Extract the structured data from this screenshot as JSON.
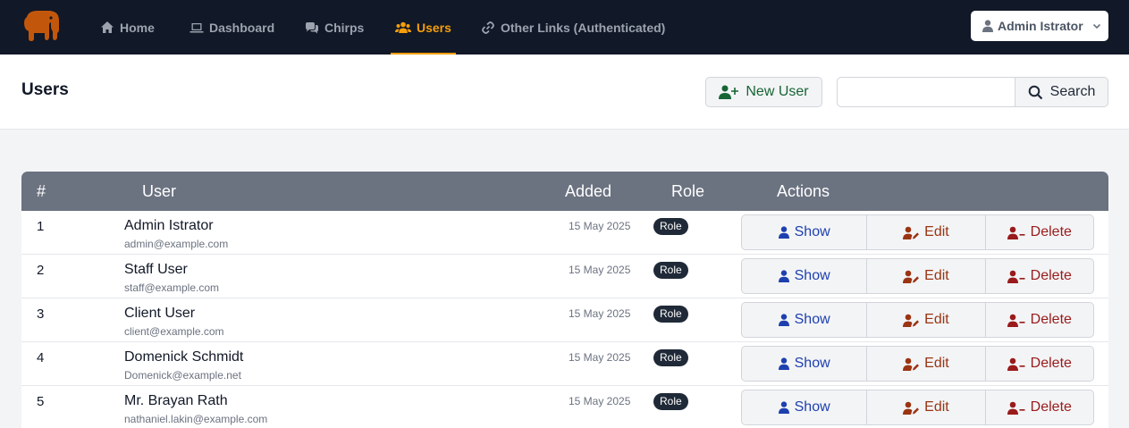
{
  "app": {
    "logo_icon": "elephant-logo-icon",
    "brand_color": "#f59e0b"
  },
  "nav": {
    "items": [
      {
        "label": "Home",
        "icon": "home-icon"
      },
      {
        "label": "Dashboard",
        "icon": "laptop-icon"
      },
      {
        "label": "Chirps",
        "icon": "chat-bubbles-icon"
      },
      {
        "label": "Users",
        "icon": "users-icon",
        "active": true
      },
      {
        "label": "Other Links (Authenticated)",
        "icon": "link-icon"
      }
    ],
    "user_menu": {
      "label": "Admin Istrator",
      "icon": "user-icon"
    }
  },
  "header": {
    "title": "Users",
    "new_user_label": "New User",
    "search_value": "",
    "search_placeholder": "",
    "search_label": "Search"
  },
  "table": {
    "columns": {
      "num": "#",
      "user": "User",
      "added": "Added",
      "role": "Role",
      "actions": "Actions"
    },
    "action_labels": {
      "show": "Show",
      "edit": "Edit",
      "delete": "Delete"
    },
    "rows": [
      {
        "num": "1",
        "name": "Admin Istrator",
        "email": "admin@example.com",
        "added": "15 May 2025",
        "role": "Role"
      },
      {
        "num": "2",
        "name": "Staff User",
        "email": "staff@example.com",
        "added": "15 May 2025",
        "role": "Role"
      },
      {
        "num": "3",
        "name": "Client User",
        "email": "client@example.com",
        "added": "15 May 2025",
        "role": "Role"
      },
      {
        "num": "4",
        "name": "Domenick Schmidt",
        "email": "Domenick@example.net",
        "added": "15 May 2025",
        "role": "Role"
      },
      {
        "num": "5",
        "name": "Mr. Brayan Rath",
        "email": "nathaniel.lakin@example.com",
        "added": "15 May 2025",
        "role": "Role"
      }
    ]
  }
}
